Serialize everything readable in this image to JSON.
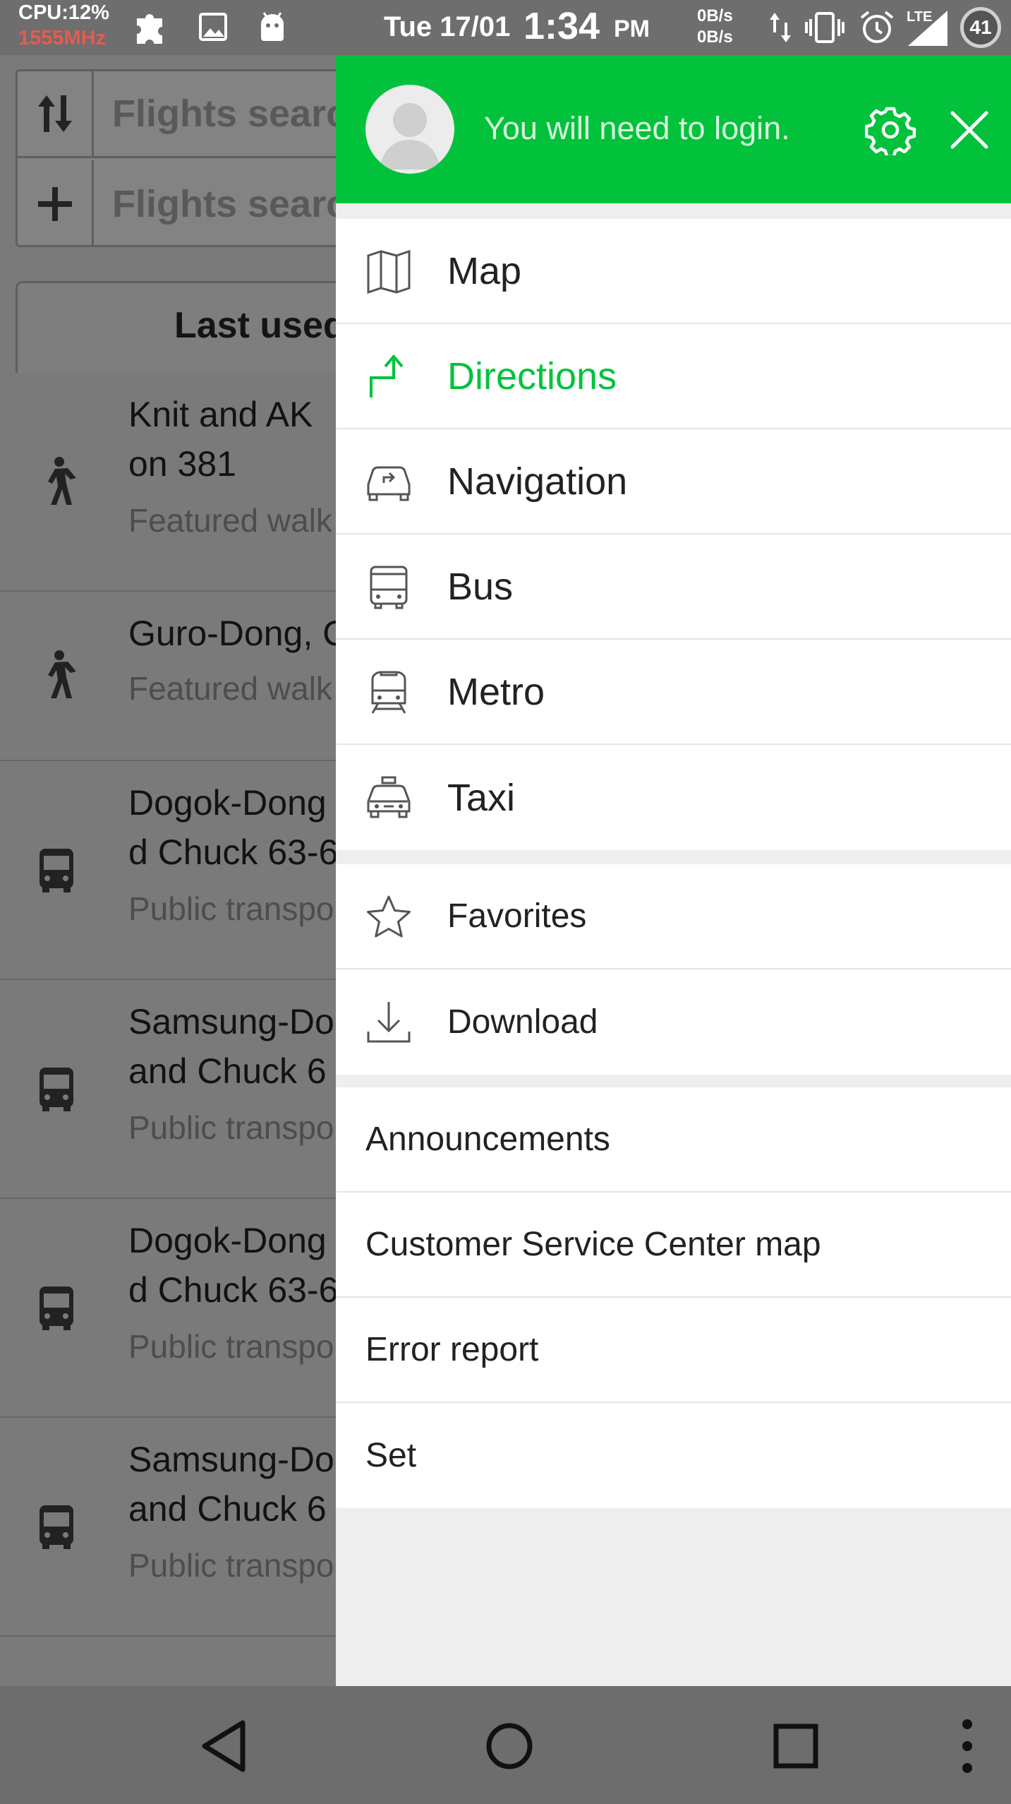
{
  "status_bar": {
    "cpu": "CPU:12%",
    "freq": "1555MHz",
    "date": "Tue 17/01",
    "time": "1:34",
    "ampm": "PM",
    "net_up": "0B/s",
    "net_down": "0B/s",
    "signal_type": "LTE",
    "battery": "41"
  },
  "background": {
    "search_rows": [
      {
        "icon": "swap-icon",
        "placeholder": "Flights searc"
      },
      {
        "icon": "plus-icon",
        "placeholder": "Flights searc"
      }
    ],
    "tab_label": "Last used",
    "items": [
      {
        "icon": "walk-icon",
        "line1": "Knit and AK",
        "line2": "on 381",
        "sub": "Featured walk"
      },
      {
        "icon": "walk-icon",
        "line1": "Guro-Dong, C",
        "line2": "",
        "sub": "Featured walk"
      },
      {
        "icon": "bus-icon",
        "line1": "Dogok-Dong",
        "line2": "d Chuck 63-6",
        "sub": "Public transpo"
      },
      {
        "icon": "bus-icon",
        "line1": "Samsung-Do",
        "line2": "and Chuck 6",
        "sub": "Public transpo"
      },
      {
        "icon": "bus-icon",
        "line1": "Dogok-Dong",
        "line2": "d Chuck 63-6",
        "sub": "Public transpo"
      },
      {
        "icon": "bus-icon",
        "line1": "Samsung-Do",
        "line2": "and Chuck 6",
        "sub": "Public transpo"
      }
    ]
  },
  "drawer": {
    "header": {
      "login_text": "You will need to login.",
      "accent": "#02c23c"
    },
    "group1": [
      {
        "icon": "map-icon",
        "label": "Map"
      },
      {
        "icon": "directions-icon",
        "label": "Directions",
        "active": true
      },
      {
        "icon": "navigation-car-icon",
        "label": "Navigation"
      },
      {
        "icon": "bus-icon",
        "label": "Bus"
      },
      {
        "icon": "metro-icon",
        "label": "Metro"
      },
      {
        "icon": "taxi-icon",
        "label": "Taxi"
      }
    ],
    "group2": [
      {
        "icon": "star-icon",
        "label": "Favorites"
      },
      {
        "icon": "download-icon",
        "label": "Download"
      }
    ],
    "group3": [
      {
        "label": "Announcements"
      },
      {
        "label": "Customer Service Center map"
      },
      {
        "label": "Error report"
      },
      {
        "label": "Set"
      }
    ]
  }
}
